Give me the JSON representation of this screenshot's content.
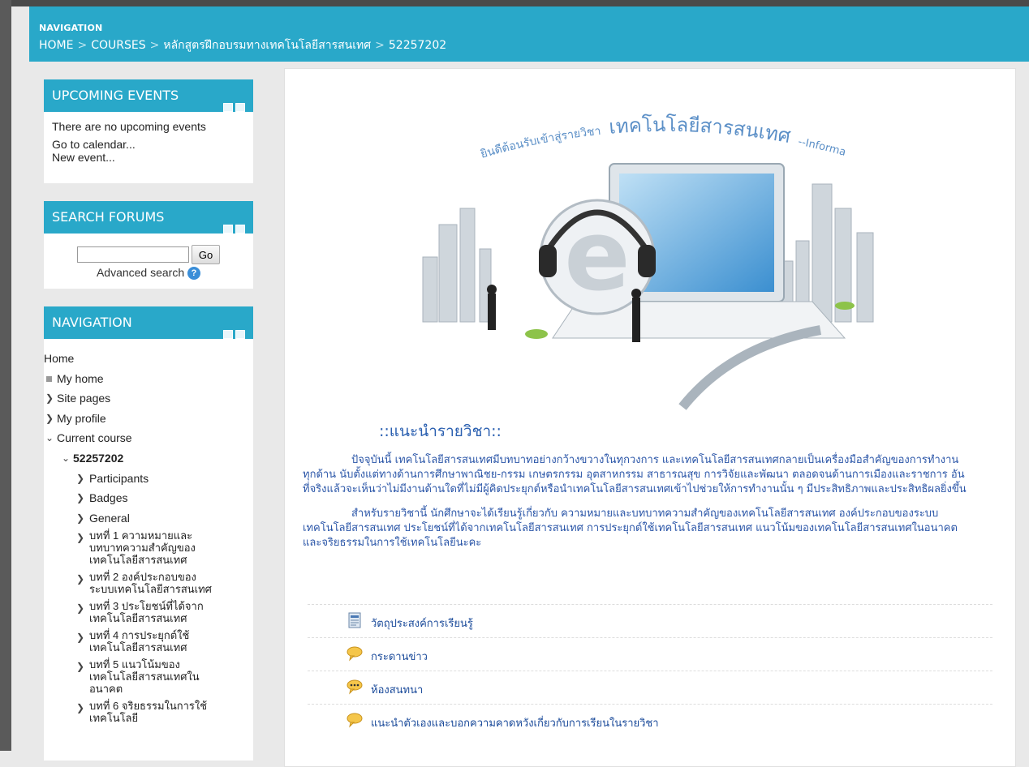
{
  "breadcrumb": {
    "label": "NAVIGATION",
    "items": [
      "HOME",
      "COURSES",
      "หลักสูตรฝึกอบรมทางเทคโนโลยีสารสนเทศ",
      "52257202"
    ],
    "separator": ">"
  },
  "upcoming_events": {
    "title": "UPCOMING EVENTS",
    "empty_text": "There are no upcoming events",
    "calendar_link": "Go to calendar...",
    "new_event_link": "New event..."
  },
  "search_forums": {
    "title": "SEARCH FORUMS",
    "input_value": "",
    "go_label": "Go",
    "advanced_label": "Advanced search",
    "help_glyph": "?"
  },
  "navigation": {
    "title": "NAVIGATION",
    "items": [
      {
        "label": "Home"
      },
      {
        "label": "My home"
      },
      {
        "label": "Site pages"
      },
      {
        "label": "My profile"
      },
      {
        "label": "Current course"
      },
      {
        "label": "52257202"
      },
      {
        "label": "Participants"
      },
      {
        "label": "Badges"
      },
      {
        "label": "General"
      },
      {
        "label": "บทที่ 1 ความหมายและบทบาทความสำคัญของเทคโนโลยีสารสนเทศ"
      },
      {
        "label": "บทที่ 2 องค์ประกอบของระบบเทคโนโลยีสารสนเทศ"
      },
      {
        "label": "บทที่ 3 ประโยชน์ที่ได้จากเทคโนโลยีสารสนเทศ"
      },
      {
        "label": "บทที่ 4 การประยุกต์ใช้เทคโนโลยีสารสนเทศ"
      },
      {
        "label": "บทที่ 5 แนวโน้มของเทคโนโลยีสารสนเทศในอนาคต"
      },
      {
        "label": "บทที่ 6 จริยธรรมในการใช้เทคโนโลยี"
      }
    ]
  },
  "hero": {
    "welcome_text": "ยินดีต้อนรับเข้าสู่รายวิชา",
    "subject_text": "เทคโนโลยีสารสนเทศ",
    "english_text": "--Information Technology--",
    "logo_letter": "e"
  },
  "course_intro": {
    "title": "::แนะนำรายวิชา::",
    "paragraph1": "ปัจจุบันนี้ เทคโนโลยีสารสนเทศมีบทบาทอย่างกว้างขวางในทุกวงการ และเทคโนโลยีสารสนเทศกลายเป็นเครื่องมือสำคัญของการทำงานทุกด้าน นับตั้งแต่ทางด้านการศึกษาพาณิชย-กรรม เกษตรกรรม อุตสาหกรรม สาธารณสุข การวิจัยและพัฒนา ตลอดจนด้านการเมืองและราชการ อันที่จริงแล้วจะเห็นว่าไม่มีงานด้านใดที่ไม่มีผู้คิดประยุกต์หรือนำเทคโนโลยีสารสนเทศเข้าไปช่วยให้การทำงานนั้น ๆ มีประสิทธิภาพและประสิทธิผลยิ่งขึ้น",
    "paragraph2": "สำหรับรายวิชานี้ นักศึกษาจะได้เรียนรู้เกี่ยวกับ ความหมายและบทบาทความสำคัญของเทคโนโลยีสารสนเทศ องค์ประกอบของระบบเทคโนโลยีสารสนเทศ ประโยชน์ที่ได้จากเทคโนโลยีสารสนเทศ การประยุกต์ใช้เทคโนโลยีสารสนเทศ แนวโน้มของเทคโนโลยีสารสนเทศในอนาคต และจริยธรรมในการใช้เทคโนโลยีนะคะ"
  },
  "activities": [
    {
      "label": "วัตถุประสงค์การเรียนรู้",
      "icon": "page-icon"
    },
    {
      "label": "กระดานข่าว",
      "icon": "forum-icon"
    },
    {
      "label": "ห้องสนทนา",
      "icon": "chat-icon"
    },
    {
      "label": "แนะนำตัวเองและบอกความคาดหวังเกี่ยวกับการเรียนในรายวิชา",
      "icon": "forum-icon"
    }
  ],
  "colors": {
    "accent": "#29a8c9",
    "link": "#2b56a8"
  }
}
